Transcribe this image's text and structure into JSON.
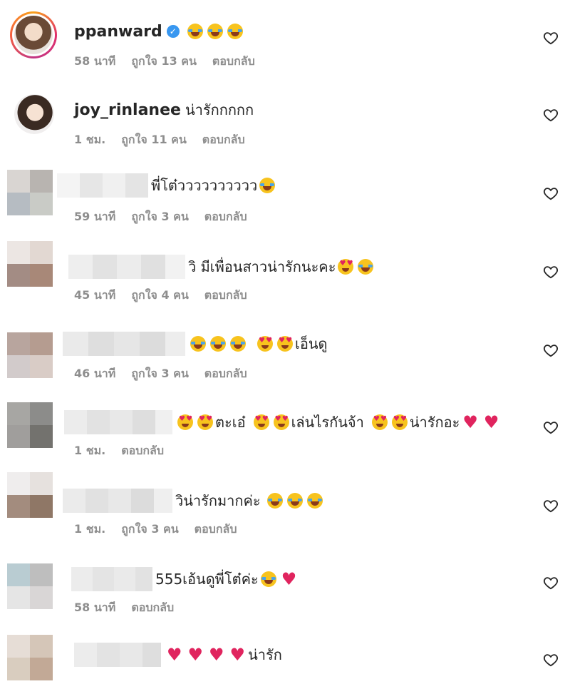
{
  "comments": [
    {
      "username": "ppanward",
      "verified": true,
      "text": "",
      "emoji": [
        "laugh",
        "laugh",
        "laugh"
      ],
      "time": "58 นาที",
      "likes": "ถูกใจ 13 คน",
      "reply": "ตอบกลับ"
    },
    {
      "username": "joy_rinlanee",
      "verified": false,
      "text": "น่ารักกกกก",
      "emoji": [],
      "time": "1 ชม.",
      "likes": "ถูกใจ 11 คน",
      "reply": "ตอบกลับ"
    },
    {
      "username": "",
      "text": "พี่โต๋วววววววววว",
      "emoji": [
        "laugh"
      ],
      "time": "59 นาที",
      "likes": "ถูกใจ 3 คน",
      "reply": "ตอบกลับ"
    },
    {
      "username": "",
      "text": "วิ มีเพื่อนสาวน่ารักนะคะ",
      "emoji": [
        "hearteyes",
        "laugh"
      ],
      "time": "45 นาที",
      "likes": "ถูกใจ 4 คน",
      "reply": "ตอบกลับ"
    },
    {
      "username": "",
      "text": "เอ็นดู",
      "emoji_before": [
        "laugh",
        "laugh",
        "laugh",
        "hearteyes",
        "hearteyes"
      ],
      "time": "46 นาที",
      "likes": "ถูกใจ 3 คน",
      "reply": "ตอบกลับ"
    },
    {
      "username": "",
      "segments": [
        "ตะเอ๋",
        "เล่นไรกันจ้า",
        "น่ารักอะ"
      ],
      "time": "1 ชม.",
      "reply": "ตอบกลับ"
    },
    {
      "username": "",
      "text": "วิน่ารักมากค่ะ",
      "emoji": [
        "laugh",
        "laugh",
        "laugh"
      ],
      "time": "1 ชม.",
      "likes": "ถูกใจ 3 คน",
      "reply": "ตอบกลับ"
    },
    {
      "username": "",
      "text": "555เอ้นดูพี่โต๋ค่ะ",
      "emoji": [
        "laugh",
        "redheart"
      ],
      "time": "58 นาที",
      "reply": "ตอบกลับ"
    },
    {
      "username": "",
      "text": "น่ารัก",
      "emoji_before": [
        "redheart",
        "redheart",
        "redheart",
        "redheart"
      ],
      "time": "",
      "reply": ""
    }
  ],
  "icons": {
    "like": "heart-outline-icon",
    "verified": "verified-badge-icon"
  },
  "colors": {
    "meta": "#8e8e8e",
    "text": "#262626",
    "verified": "#3897f0",
    "heart": "#e0245e"
  }
}
